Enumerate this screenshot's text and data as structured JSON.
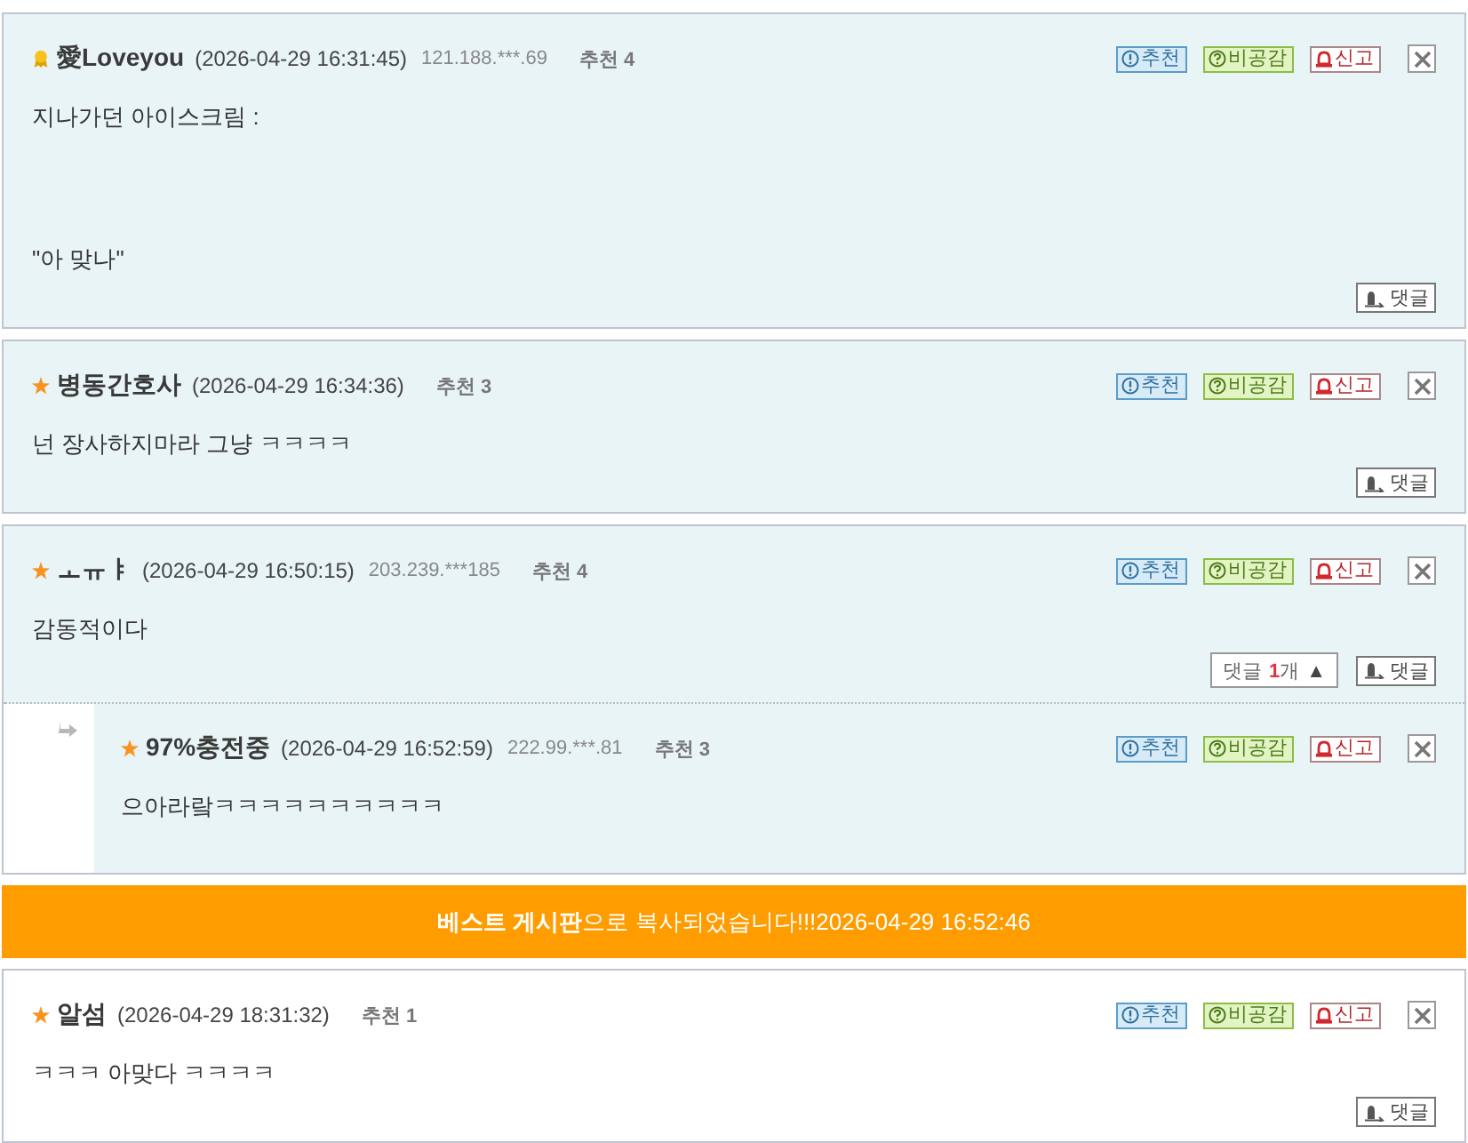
{
  "thread": [
    {
      "kind": "comment",
      "highlighted": true,
      "badge": {
        "kind": "medal"
      },
      "name": "愛Loveyou",
      "date": "(2026-04-29 16:31:45)",
      "ip": "121.188.***.69",
      "recommend": "추천 4",
      "actions": [
        {
          "kind": "recommend",
          "label": "추천"
        },
        {
          "kind": "dislike",
          "label": "비공감"
        },
        {
          "kind": "report",
          "label": "신고"
        }
      ],
      "body": "지나가던 아이스크림 :\n\n\n\n\"아 맞나\"",
      "reply_button": "댓글"
    },
    {
      "kind": "comment",
      "highlighted": true,
      "badge": {
        "kind": "star"
      },
      "name": "병동간호사",
      "date": "(2026-04-29 16:34:36)",
      "recommend": "추천 3",
      "actions": [
        {
          "kind": "recommend",
          "label": "추천"
        },
        {
          "kind": "dislike",
          "label": "비공감"
        },
        {
          "kind": "report",
          "label": "신고"
        }
      ],
      "body": "넌 장사하지마라 그냥 ㅋㅋㅋㅋ",
      "reply_button": "댓글"
    },
    {
      "kind": "comment",
      "highlighted": true,
      "badge": {
        "kind": "star"
      },
      "name": "ㅗㅠㅑ",
      "date": "(2026-04-29 16:50:15)",
      "ip": "203.239.***185",
      "recommend": "추천 4",
      "actions": [
        {
          "kind": "recommend",
          "label": "추천"
        },
        {
          "kind": "dislike",
          "label": "비공감"
        },
        {
          "kind": "report",
          "label": "신고"
        }
      ],
      "body": "감동적이다",
      "reply_toggle": {
        "label": "댓글",
        "count": "1",
        "unit": "개",
        "arrow": "▲"
      },
      "reply_button": "댓글",
      "replies": [
        {
          "highlighted": true,
          "badge": {
            "kind": "star"
          },
          "name": "97%충전중",
          "date": "(2026-04-29 16:52:59)",
          "ip": "222.99.***.81",
          "recommend": "추천 3",
          "actions": [
            {
              "kind": "recommend",
              "label": "추천"
            },
            {
              "kind": "dislike",
              "label": "비공감"
            },
            {
              "kind": "report",
              "label": "신고"
            }
          ],
          "body": "으아라랔ㅋㅋㅋㅋㅋㅋㅋㅋㅋㅋ"
        }
      ]
    },
    {
      "kind": "notice",
      "text": "**베스트 게시판**으로 복사되었습니다!!!2026-04-29 16:52:46"
    },
    {
      "kind": "comment",
      "highlighted": false,
      "badge": {
        "kind": "star"
      },
      "name": "알섬",
      "date": "(2026-04-29 18:31:32)",
      "recommend": "추천 1",
      "actions": [
        {
          "kind": "recommend",
          "label": "추천"
        },
        {
          "kind": "dislike",
          "label": "비공감"
        },
        {
          "kind": "report",
          "label": "신고"
        }
      ],
      "body": "ㅋㅋㅋ 아맞다 ㅋㅋㅋㅋ",
      "reply_button": "댓글"
    }
  ]
}
